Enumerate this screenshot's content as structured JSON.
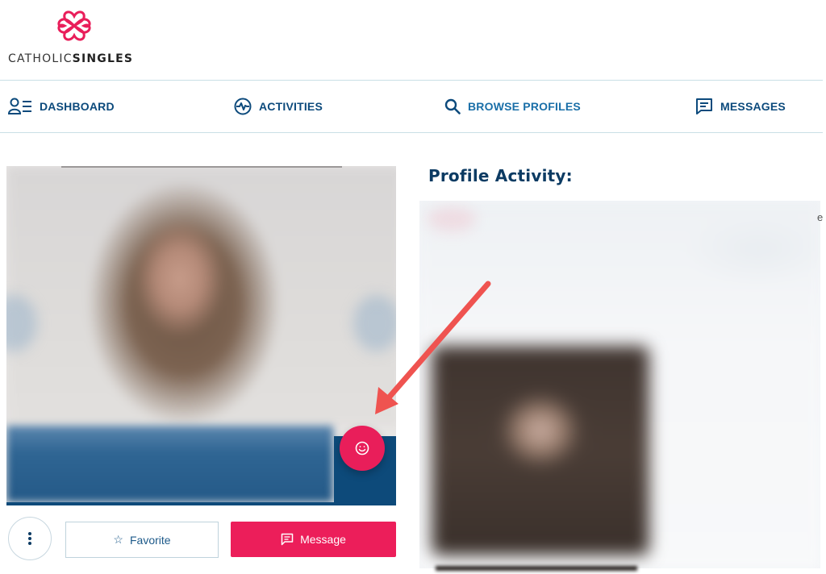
{
  "brand": {
    "name_light": "CATHOLIC",
    "name_bold": "SINGLES",
    "accent_color": "#e91e5a",
    "logo_icon": "interlocking-hearts-icon"
  },
  "nav": {
    "items": [
      {
        "label": "DASHBOARD",
        "icon": "user-list-icon"
      },
      {
        "label": "ACTIVITIES",
        "icon": "heartbeat-icon"
      },
      {
        "label": "BROWSE PROFILES",
        "icon": "search-icon"
      },
      {
        "label": "MESSAGES",
        "icon": "message-icon"
      }
    ]
  },
  "profile": {
    "smile_icon": "smile-icon",
    "actions": {
      "more_icon": "more-vertical-icon",
      "favorite_label": "Favorite",
      "favorite_icon": "star-icon",
      "message_label": "Message",
      "message_icon": "chat-icon"
    }
  },
  "activity": {
    "title": "Profile Activity:",
    "edge_text": "e"
  },
  "colors": {
    "nav_text": "#0c4a7c",
    "nav_active": "#1a6fa8",
    "primary_blue": "#0d4a7a",
    "pink": "#ec1e5a",
    "annotation_arrow": "#ef5350"
  }
}
